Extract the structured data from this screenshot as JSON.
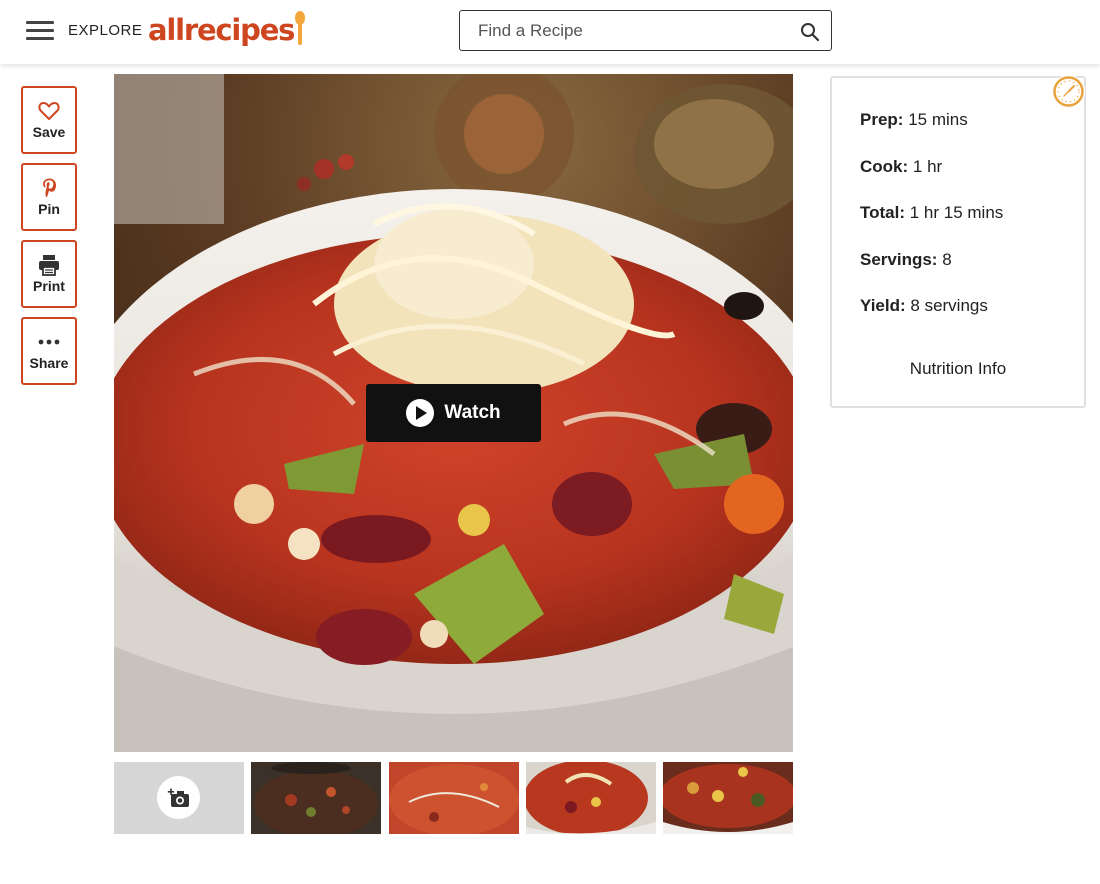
{
  "header": {
    "explore_label": "EXPLORE",
    "logo_text": "allrecipes",
    "search_placeholder": "Find a Recipe",
    "brand_color": "#ce4620",
    "accent_color": "#f3a63b"
  },
  "actions": [
    {
      "label": "Save",
      "icon": "heart-icon"
    },
    {
      "label": "Pin",
      "icon": "pinterest-icon"
    },
    {
      "label": "Print",
      "icon": "printer-icon"
    },
    {
      "label": "Share",
      "icon": "more-dots-icon"
    }
  ],
  "hero": {
    "watch_label": "Watch",
    "description": "Bowl of vegetable chili topped with shredded cheese"
  },
  "thumbnails": {
    "add_photo_icon": "add-photo-camera-icon",
    "count": 4
  },
  "info": {
    "prep_label": "Prep:",
    "prep_value": "15 mins",
    "cook_label": "Cook:",
    "cook_value": "1 hr",
    "total_label": "Total:",
    "total_value": "1 hr 15 mins",
    "servings_label": "Servings:",
    "servings_value": "8",
    "yield_label": "Yield:",
    "yield_value": "8 servings",
    "nutrition_link": "Nutrition Info",
    "icon": "clock-icon"
  }
}
